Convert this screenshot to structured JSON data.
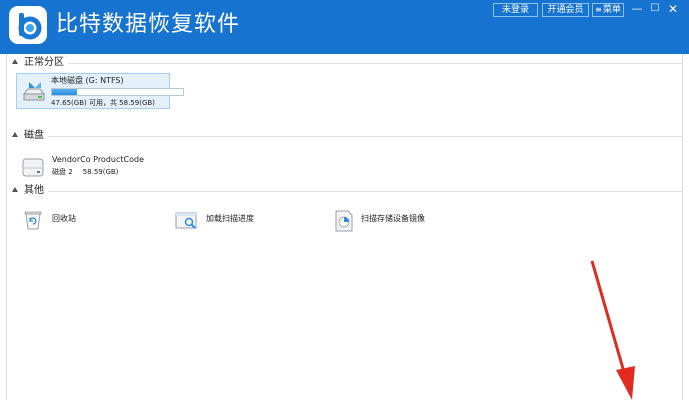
{
  "app": {
    "title": "比特数据恢复软件",
    "logo_icon": "app-logo-b-icon",
    "brand_color": "#1673d0"
  },
  "titlebar": {
    "login_label": "未登录",
    "vip_label": "开通会员",
    "menu_label": "菜单",
    "menu_icon": "hamburger-icon",
    "minimize_glyph": "—",
    "maximize_glyph": "☐",
    "close_glyph": "✕"
  },
  "sections": {
    "partitions": {
      "title": "正常分区"
    },
    "disks": {
      "title": "磁盘"
    },
    "other": {
      "title": "其他"
    }
  },
  "partition": {
    "name": "本地磁盘 (G: NTFS)",
    "info": "47.65(GB) 可用，共 58.59(GB)",
    "used_fraction": 0.19,
    "icon": "drive-icon"
  },
  "disk": {
    "name": "VendorCo ProductCode",
    "label": "磁盘 2",
    "size": "58.59(GB)",
    "icon": "hard-disk-icon"
  },
  "other_items": [
    {
      "label": "回收站",
      "icon": "recycle-bin-icon"
    },
    {
      "label": "加载扫描进度",
      "icon": "load-scan-progress-icon"
    },
    {
      "label": "扫描存储设备镜像",
      "icon": "scan-image-icon"
    }
  ],
  "annotation": {
    "arrow_color": "#e02b1e"
  }
}
